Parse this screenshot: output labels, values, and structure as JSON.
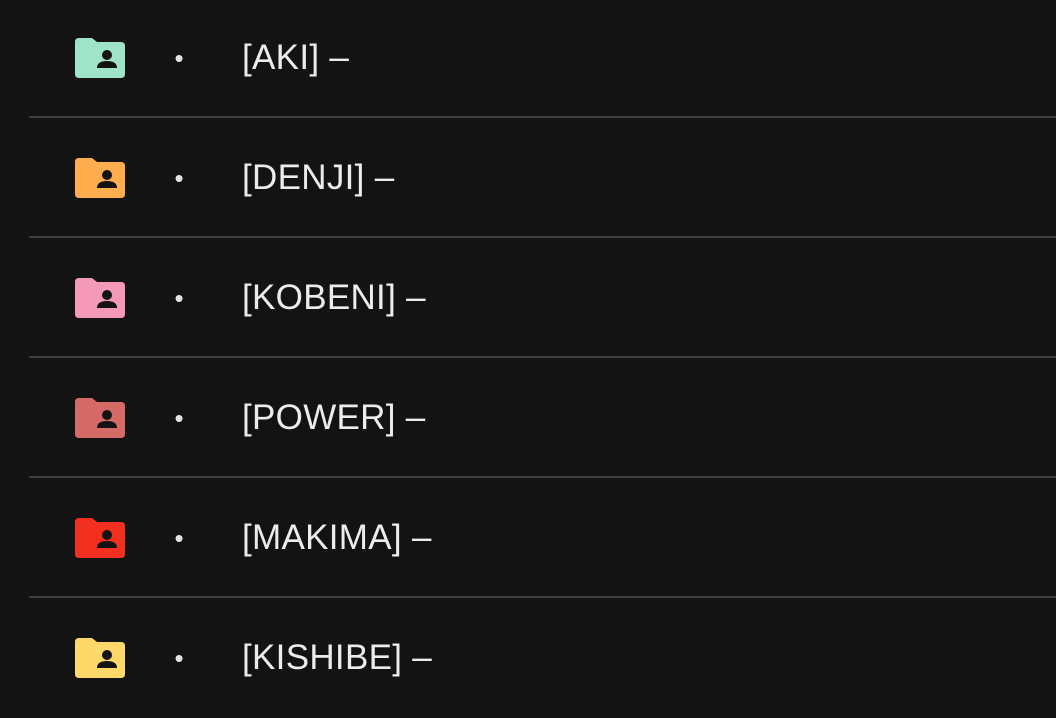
{
  "items": [
    {
      "label": "[AKI] –",
      "bullet": "•",
      "icon": "folder-shared-icon",
      "color": "#9fe3c8"
    },
    {
      "label": "[DENJI] –",
      "bullet": "•",
      "icon": "folder-shared-icon",
      "color": "#ffad4f"
    },
    {
      "label": "[KOBENI] –",
      "bullet": "•",
      "icon": "folder-shared-icon",
      "color": "#f49ab8"
    },
    {
      "label": "[POWER] –",
      "bullet": "•",
      "icon": "folder-shared-icon",
      "color": "#d66a66"
    },
    {
      "label": "[MAKIMA] –",
      "bullet": "•",
      "icon": "folder-shared-icon",
      "color": "#f3301f"
    },
    {
      "label": "[KISHIBE] –",
      "bullet": "•",
      "icon": "folder-shared-icon",
      "color": "#ffd86a"
    }
  ],
  "colors": {
    "background": "#131313",
    "divider": "#3e3e3e",
    "text": "#ececec"
  }
}
